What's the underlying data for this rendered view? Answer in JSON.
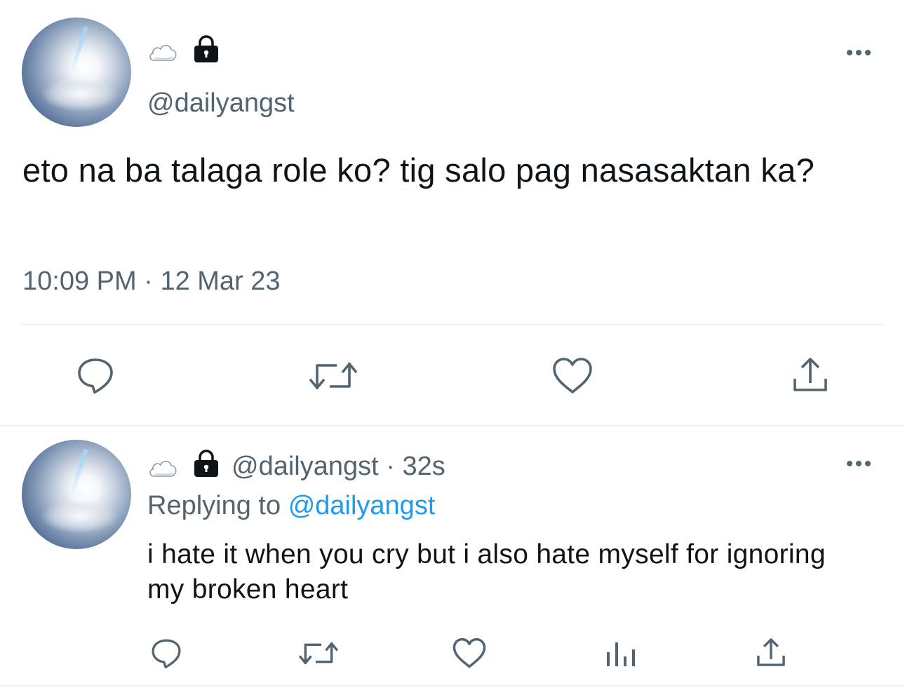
{
  "main_tweet": {
    "display_name_emoji": "☁️",
    "handle": "@dailyangst",
    "text": "eto na ba talaga role ko? tig salo pag nasasaktan ka?",
    "time": "10:09 PM",
    "separator": "·",
    "date": "12 Mar 23",
    "actions": [
      "reply-icon",
      "retweet-icon",
      "like-icon",
      "share-icon"
    ]
  },
  "reply_tweet": {
    "display_name_emoji": "☁️",
    "handle": "@dailyangst",
    "separator": "·",
    "age": "32s",
    "replying_prefix": "Replying to",
    "replying_to": "@dailyangst",
    "text": "i hate it when you cry but i also hate myself for ignoring my broken heart",
    "actions": [
      "reply-icon",
      "retweet-icon",
      "like-icon",
      "views-icon",
      "share-icon"
    ]
  },
  "colors": {
    "text": "#0f1419",
    "secondary": "#536471",
    "link": "#1d9bf0",
    "divider": "#eff3f4"
  }
}
